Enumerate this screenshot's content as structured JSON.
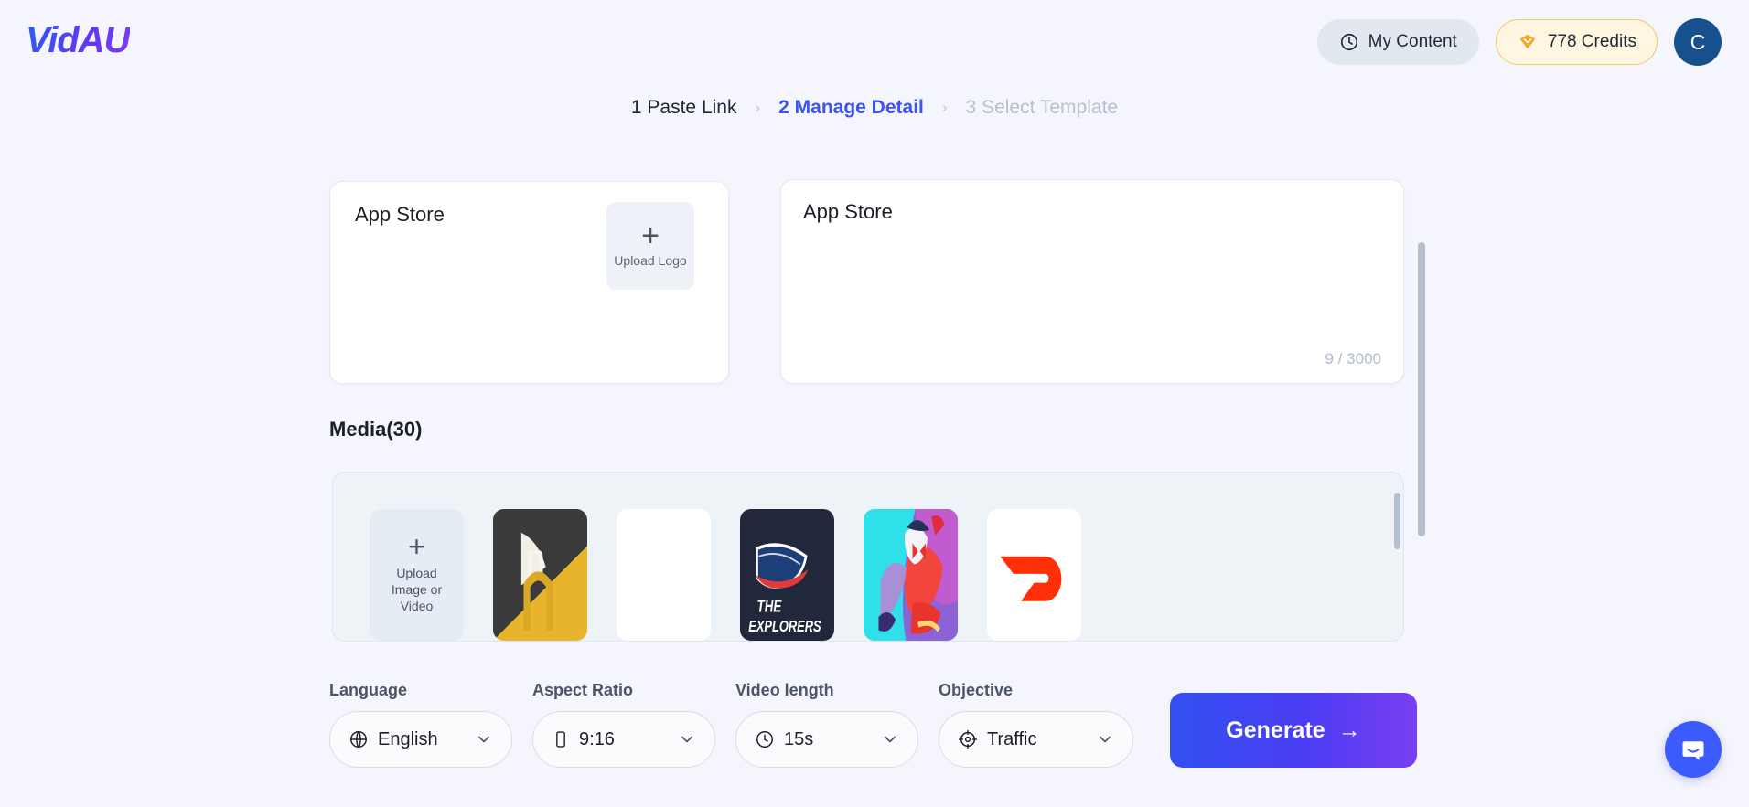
{
  "header": {
    "logo_text": "VidAU",
    "my_content_label": "My Content",
    "my_content_icon": "clock-icon",
    "credits_label": "778 Credits",
    "credits_icon": "gem-icon",
    "avatar_initial": "C",
    "avatar_color": "#16508f"
  },
  "stepper": {
    "separator": "›",
    "steps": [
      {
        "label": "1 Paste Link",
        "state": "done"
      },
      {
        "label": "2 Manage Detail",
        "state": "active"
      },
      {
        "label": "3 Select Template",
        "state": "todo"
      }
    ],
    "active_color": "#3b54f0",
    "todo_color": "#b9bece"
  },
  "app_card": {
    "title": "App Store",
    "upload_logo_label": "Upload Logo",
    "upload_logo_icon": "plus-icon"
  },
  "description_card": {
    "text": "App Store",
    "counter": "9 / 3000"
  },
  "media": {
    "section_title": "Media(30)",
    "upload_tile": {
      "label": "Upload Image or Video",
      "icon": "plus-icon"
    },
    "items": [
      {
        "name": "nook-app-icon",
        "alt": "Yellow and black app icon with letter n and page curl"
      },
      {
        "name": "blank-white-thumbnail",
        "alt": "Blank white thumbnail"
      },
      {
        "name": "the-explorers-app-icon",
        "alt": "THE EXPLORERS navy icon with flag",
        "caption": "THE EXPLORERS"
      },
      {
        "name": "game-character-app-icon",
        "alt": "Colorful game character icon"
      },
      {
        "name": "doordash-app-icon",
        "alt": "DoorDash white icon with red D"
      }
    ]
  },
  "controls": [
    {
      "label": "Language",
      "value": "English",
      "icon": "globe-icon"
    },
    {
      "label": "Aspect Ratio",
      "value": "9:16",
      "icon": "phone-icon"
    },
    {
      "label": "Video length",
      "value": "15s",
      "icon": "clock-icon"
    },
    {
      "label": "Objective",
      "value": "Traffic",
      "icon": "target-icon"
    }
  ],
  "generate_button": {
    "label": "Generate",
    "arrow": "→"
  },
  "chat_widget": {
    "icon": "chat-bubble-icon",
    "color": "#3b5bfd"
  }
}
